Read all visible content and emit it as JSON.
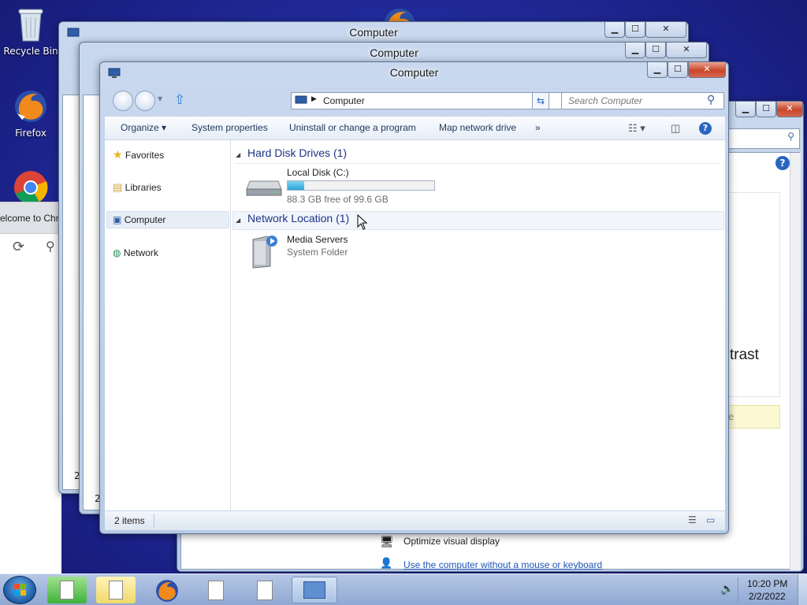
{
  "desktop": {
    "icons": [
      {
        "label": "Recycle Bin",
        "icon": "recycle-bin-icon"
      },
      {
        "label": "Firefox",
        "icon": "firefox-icon"
      },
      {
        "label": "",
        "icon": "chrome-icon"
      }
    ]
  },
  "background_windows": {
    "window1_title": "Computer",
    "window2_title": "Computer",
    "window1_fragment": "2",
    "window2_fragment": "2",
    "chrome_tab_text": "elcome to Chro",
    "right_window": {
      "contrast_fragment": "trast",
      "yellow_fragment": "e",
      "link1": "Optimize visual display",
      "link2": "Use the computer without a mouse or keyboard"
    }
  },
  "explorer": {
    "title": "Computer",
    "address": "Computer",
    "search_placeholder": "Search Computer",
    "commands": [
      "Organize",
      "System properties",
      "Uninstall or change a program",
      "Map network drive"
    ],
    "more": "»",
    "nav": [
      "Favorites",
      "Libraries",
      "Computer",
      "Network"
    ],
    "groups": [
      {
        "header": "Hard Disk Drives (1)"
      },
      {
        "header": "Network Location (1)"
      }
    ],
    "drive": {
      "name": "Local Disk (C:)",
      "free": "88.3 GB free of 99.6 GB",
      "used_fraction": 0.113
    },
    "media": {
      "name": "Media Servers",
      "type": "System Folder"
    },
    "status": "2 items"
  },
  "taskbar": {
    "time": "10:20 PM",
    "date": "2/2/2022"
  },
  "colors": {
    "accent": "#1e3287",
    "drive_fill": "#2aa7d9",
    "desktop": "#2630a6"
  }
}
